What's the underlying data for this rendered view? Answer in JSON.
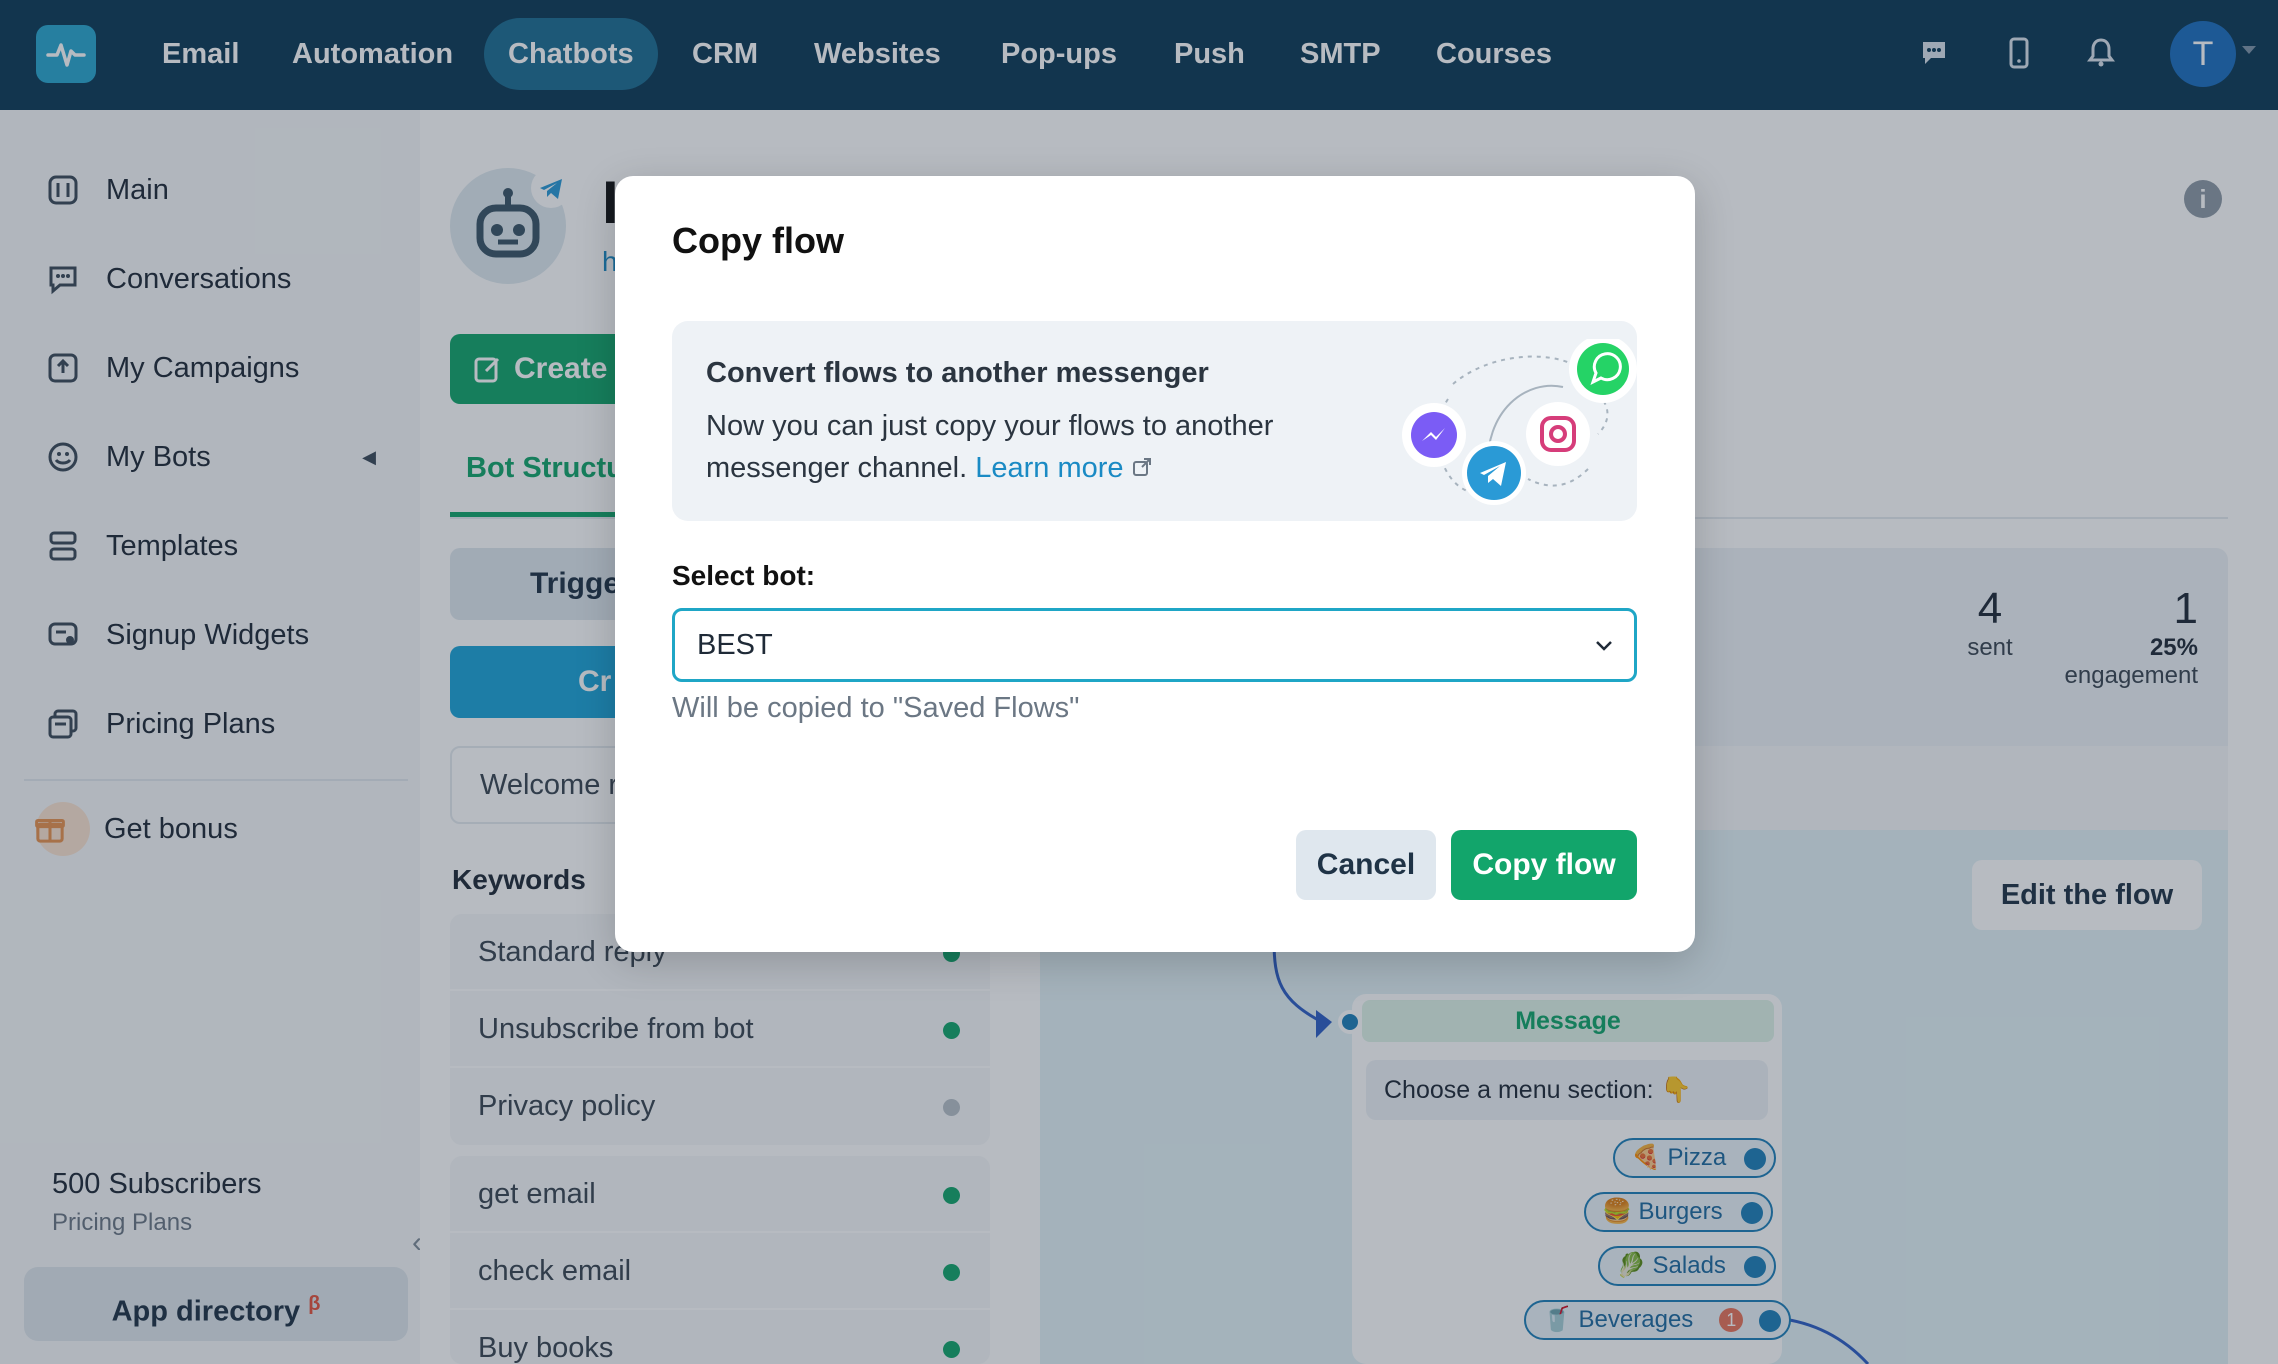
{
  "nav": {
    "items": [
      "Email",
      "Automation",
      "Chatbots",
      "CRM",
      "Websites",
      "Pop-ups",
      "Push",
      "SMTP",
      "Courses"
    ],
    "active": "Chatbots",
    "avatar_initial": "T",
    "icons": [
      "chat-icon",
      "mobile-icon",
      "bell-icon"
    ]
  },
  "sidebar": {
    "items": [
      {
        "label": "Main",
        "icon": "dashboard-icon"
      },
      {
        "label": "Conversations",
        "icon": "chat-icon"
      },
      {
        "label": "My Campaigns",
        "icon": "campaign-icon"
      },
      {
        "label": "My Bots",
        "icon": "bot-icon"
      },
      {
        "label": "Templates",
        "icon": "templates-icon"
      },
      {
        "label": "Signup Widgets",
        "icon": "widget-icon"
      },
      {
        "label": "Pricing Plans",
        "icon": "pricing-icon"
      }
    ],
    "bonus": "Get bonus",
    "subscribers": "500 Subscribers",
    "subscribers_sub": "Pricing Plans",
    "app_directory": "App directory",
    "beta": "β"
  },
  "page": {
    "title_partial": "I",
    "link_partial": "h",
    "create_label": "Create",
    "tab_label": "Bot Structu",
    "trigger_label": "Trigge",
    "cr_label": "Cr",
    "welcome_label": "Welcome r",
    "keywords_heading": "Keywords",
    "keywords_group1": [
      {
        "label": "Standard reply",
        "status": "active"
      },
      {
        "label": "Unsubscribe from bot",
        "status": "active"
      },
      {
        "label": "Privacy policy",
        "status": "inactive"
      }
    ],
    "keywords_group2": [
      {
        "label": "get email",
        "status": "active"
      },
      {
        "label": "check email",
        "status": "active"
      },
      {
        "label": "Buy books",
        "status": "active"
      }
    ],
    "stats": {
      "sent_value": "4",
      "sent_label": "sent",
      "engagement_value": "1",
      "engagement_percent": "25%",
      "engagement_label": "engagement"
    },
    "edit_flow": "Edit the flow",
    "flow": {
      "message_title": "Message",
      "message_text": "Choose a menu section:  👇",
      "buttons": [
        "🍕 Pizza",
        "🍔 Burgers",
        "🥬 Salads",
        "🥤 Beverages"
      ],
      "beverages_badge": "1"
    }
  },
  "modal": {
    "title": "Copy flow",
    "promo_heading": "Convert flows to another messenger",
    "promo_text": "Now you can just copy your flows to another messenger channel.",
    "promo_link": "Learn more",
    "select_label": "Select bot:",
    "select_value": "BEST",
    "hint": "Will be copied to \"Saved Flows\"",
    "cancel": "Cancel",
    "copy": "Copy flow"
  }
}
